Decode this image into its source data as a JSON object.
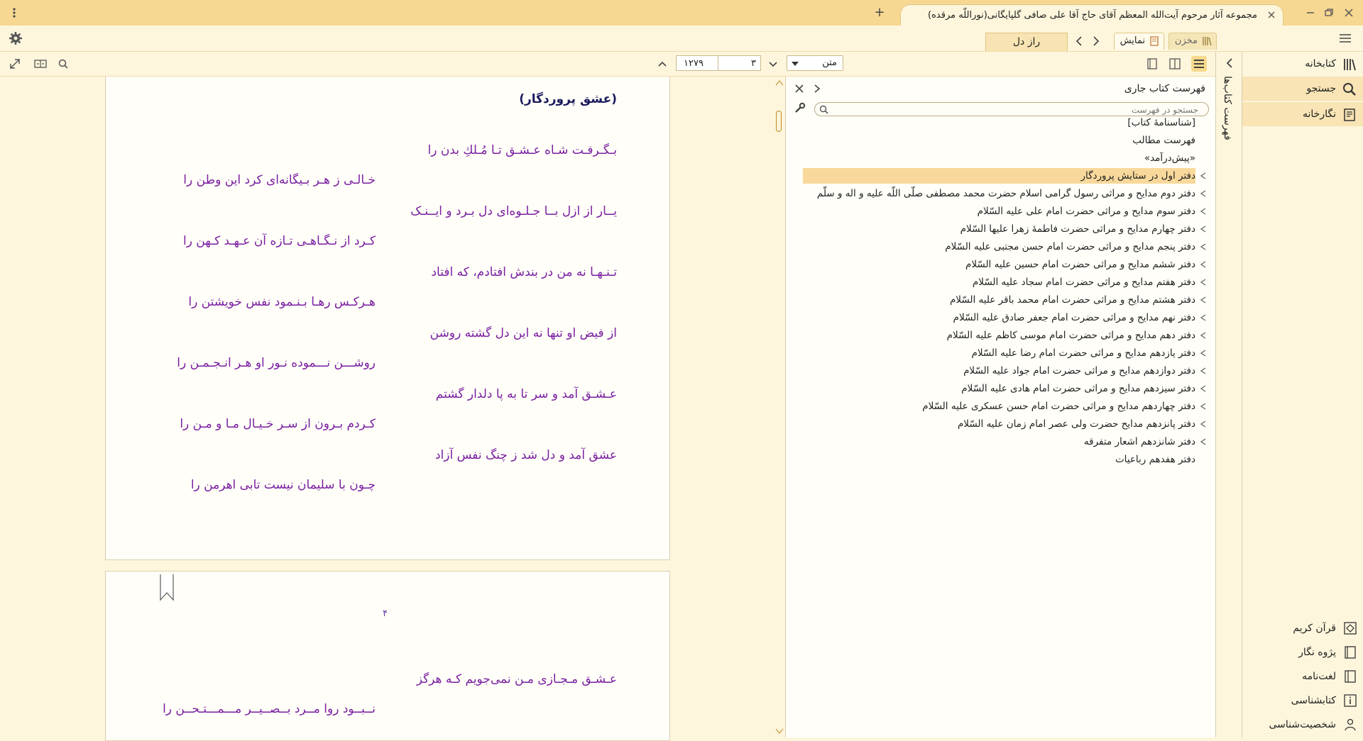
{
  "window": {
    "title": "مجموعه آثار مرحوم آیت‌الله المعظم آقای حاج آقا علی صافی گلپایگانی(نوراللّه مرقده)"
  },
  "tabs": {
    "makhzan": "مخزن",
    "namayesh": "نمایش",
    "book_tab": "راز دل"
  },
  "toolbar": {
    "view_mode": "متن",
    "current_page": "۳",
    "total_pages": "۱۲۷۹"
  },
  "book": {
    "poem_title": "(عشق پروردگار)",
    "verses": [
      {
        "right": "بـگـرفـت شـاه عـشـق تـا مُـلكِ بدن را",
        "left": "خـالـی ز هـر بـیگانه‌ای کرد این وطن را"
      },
      {
        "right": "یــار از ازل بــا جـلـوه‌ای دل بـرد و ایــنـک",
        "left": "کـرد از نـگـاهـی تـازه آن عـهـد کـهن را"
      },
      {
        "right": "تـنـهـا نه من در بندش افتادم، که افتاد",
        "left": "هـرکـس رهـا بـنـمود نفس خویشتن را"
      },
      {
        "right": "از فیض او تنها نه این دل گشته روشن",
        "left": "روشـــن نـــموده نـور او هـر انـجـمـن را"
      },
      {
        "right": "عـشـق آمد و سر تا به پا دلدار گشتم",
        "left": "کـردم بـرون از سـر خـیـال مـا و مـن را"
      },
      {
        "right": "عشق آمد و دل شد ز چنگ نفس آزاد",
        "left": "چـون با سلیمان نیست تابی اهرمن را"
      }
    ],
    "page2_number": "۴",
    "page2_verse": {
      "right": "عـشـق مـجـازی مـن نمی‌جویم کـه هرگز",
      "left": "نــبــود روا مــرد بــصــیــر مـــمـــتـحــن را"
    }
  },
  "toc": {
    "title": "فهرست کتاب جاری",
    "search_placeholder": "جستجو در فهرست",
    "items": [
      {
        "label": "[شناسنامهٔ کتاب]",
        "arrow": false
      },
      {
        "label": "فهرست مطالب",
        "arrow": false
      },
      {
        "label": "«پیش‌درآمد»",
        "arrow": false
      },
      {
        "label": "دفتر اول در ستایش پروردگار",
        "arrow": true,
        "selected": true
      },
      {
        "label": "دفتر دوم مدایح و مراثی رسول گرامی اسلام حضرت محمد مصطفی صلّی اللّه علیه و اله و سلّم",
        "arrow": true
      },
      {
        "label": "دفتر سوم مدایح و مراثی حضرت امام علی علیه السّلام",
        "arrow": true
      },
      {
        "label": "دفتر چهارم مدایح و مراثی حضرت فاطمهٔ زهرا علیها السّلام",
        "arrow": true
      },
      {
        "label": "دفتر پنجم مدایح و مراثی حضرت امام حسن مجتبی علیه السّلام",
        "arrow": true
      },
      {
        "label": "دفتر ششم مدایح و مراثی حضرت امام حسین علیه السّلام",
        "arrow": true
      },
      {
        "label": "دفتر هفتم مدایح و مراثی حضرت امام سجاد علیه السّلام",
        "arrow": true
      },
      {
        "label": "دفتر هشتم مدایح و مراثی حضرت امام محمد باقر علیه السّلام",
        "arrow": true
      },
      {
        "label": "دفتر نهم مدایح و مراثی حضرت امام جعفر صادق علیه السّلام",
        "arrow": true
      },
      {
        "label": "دفتر دهم مدایح و مراثی حضرت امام موسی کاظم علیه السّلام",
        "arrow": true
      },
      {
        "label": "دفتر یازدهم مدایح و مراثی حضرت امام رضا علیه السّلام",
        "arrow": true
      },
      {
        "label": "دفتر دوازدهم مدایح و مراثی حضرت امام جواد علیه السّلام",
        "arrow": true
      },
      {
        "label": "دفتر سیزدهم مدایح و مراثی حضرت امام هادی علیه السّلام",
        "arrow": true
      },
      {
        "label": "دفتر چهاردهم مدایح و مراثی حضرت امام حسن عسکری علیه السّلام",
        "arrow": true
      },
      {
        "label": "دفتر پانزدهم مدایح حضرت ولی عصر امام زمان علیه السّلام",
        "arrow": true
      },
      {
        "label": "دفتر شانزدهم اشعار متفرقه",
        "arrow": true
      },
      {
        "label": "دفتر هفدهم رباعیات",
        "arrow": false
      }
    ]
  },
  "vertical_tab": "فهرست کتاب‌ها",
  "sidebar": {
    "items": [
      {
        "label": "کتابخانه",
        "icon": "library-icon"
      },
      {
        "label": "جستجو",
        "icon": "search-icon"
      },
      {
        "label": "نگارخانه",
        "icon": "gallery-icon"
      }
    ],
    "bottom_items": [
      {
        "label": "قرآن کریم",
        "icon": "quran-icon"
      },
      {
        "label": "پژوه نگار",
        "icon": "notes-icon"
      },
      {
        "label": "لغت‌نامه",
        "icon": "dictionary-icon"
      },
      {
        "label": "کتابشناسی",
        "icon": "info-icon"
      },
      {
        "label": "شخصیت‌شناسی",
        "icon": "person-icon"
      }
    ]
  },
  "colors": {
    "accent": "#f6d892",
    "selected": "#f8d99b",
    "verse": "#7a1fa2",
    "title": "#1a1a5e"
  }
}
